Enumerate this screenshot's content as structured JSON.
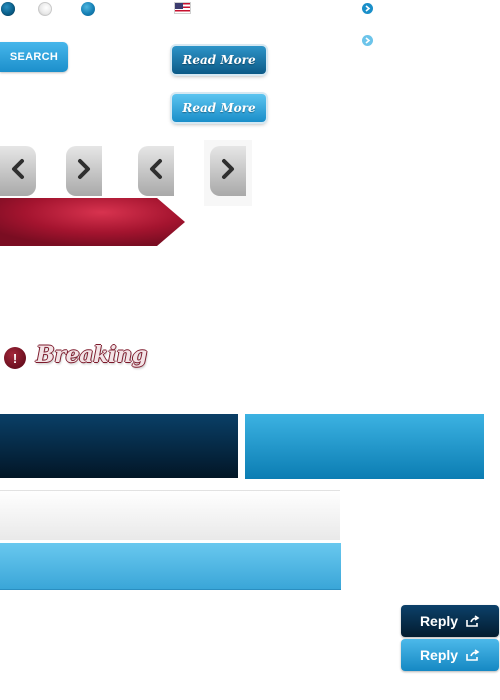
{
  "top_row": {
    "radios": [
      {
        "icon": "radio-dark-dot"
      },
      {
        "icon": "radio-white-dot"
      },
      {
        "icon": "radio-blue-dot"
      }
    ],
    "flag_icon": "us-flag-icon",
    "arrow_icons": [
      "circle-arrow-right-icon",
      "circle-arrow-right-icon"
    ]
  },
  "search": {
    "label": "SEARCH"
  },
  "read_more": {
    "dark_label": "Read More",
    "light_label": "Read More"
  },
  "nav": {
    "icons": [
      "chevron-left-icon",
      "chevron-right-icon",
      "chevron-left-icon",
      "chevron-right-icon"
    ]
  },
  "breaking": {
    "label": "Breaking",
    "icon_glyph": "!"
  },
  "reply": {
    "dark_label": "Reply",
    "light_label": "Reply"
  },
  "colors": {
    "brand_blue": "#1c8fcb",
    "dark_navy": "#021626",
    "crimson": "#a0122e",
    "breaking_red": "#6b0f1f"
  }
}
